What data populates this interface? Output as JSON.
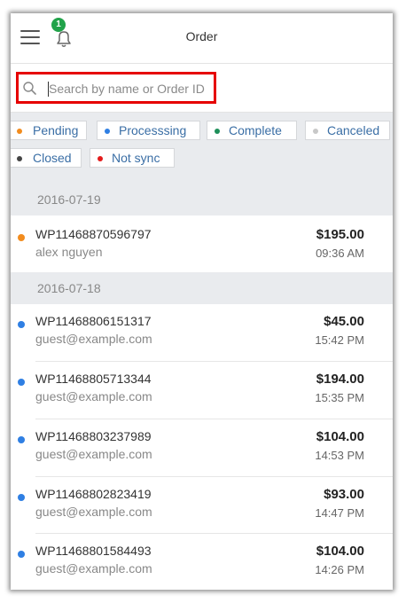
{
  "header": {
    "title": "Order",
    "notification_count": "1"
  },
  "search": {
    "placeholder": "Search by name or Order ID"
  },
  "filters": [
    {
      "label": "Pending",
      "color": "#f28c1e"
    },
    {
      "label": "Processsing",
      "color": "#2f7fe3"
    },
    {
      "label": "Complete",
      "color": "#1e8f5a"
    },
    {
      "label": "Canceled",
      "color": "#c8c8c8"
    },
    {
      "label": "Closed",
      "color": "#444444"
    },
    {
      "label": "Not sync",
      "color": "#e41b1b"
    }
  ],
  "sections": [
    {
      "date": "2016-07-19",
      "orders": [
        {
          "id": "WP11468870596797",
          "customer": "alex nguyen",
          "amount": "$195.00",
          "time": "09:36 AM",
          "status_color": "#f28c1e"
        }
      ]
    },
    {
      "date": "2016-07-18",
      "orders": [
        {
          "id": "WP11468806151317",
          "customer": "guest@example.com",
          "amount": "$45.00",
          "time": "15:42 PM",
          "status_color": "#2f7fe3"
        },
        {
          "id": "WP11468805713344",
          "customer": "guest@example.com",
          "amount": "$194.00",
          "time": "15:35 PM",
          "status_color": "#2f7fe3"
        },
        {
          "id": "WP11468803237989",
          "customer": "guest@example.com",
          "amount": "$104.00",
          "time": "14:53 PM",
          "status_color": "#2f7fe3"
        },
        {
          "id": "WP11468802823419",
          "customer": "guest@example.com",
          "amount": "$93.00",
          "time": "14:47 PM",
          "status_color": "#2f7fe3"
        },
        {
          "id": "WP11468801584493",
          "customer": "guest@example.com",
          "amount": "$104.00",
          "time": "14:26 PM",
          "status_color": "#2f7fe3"
        }
      ]
    }
  ]
}
